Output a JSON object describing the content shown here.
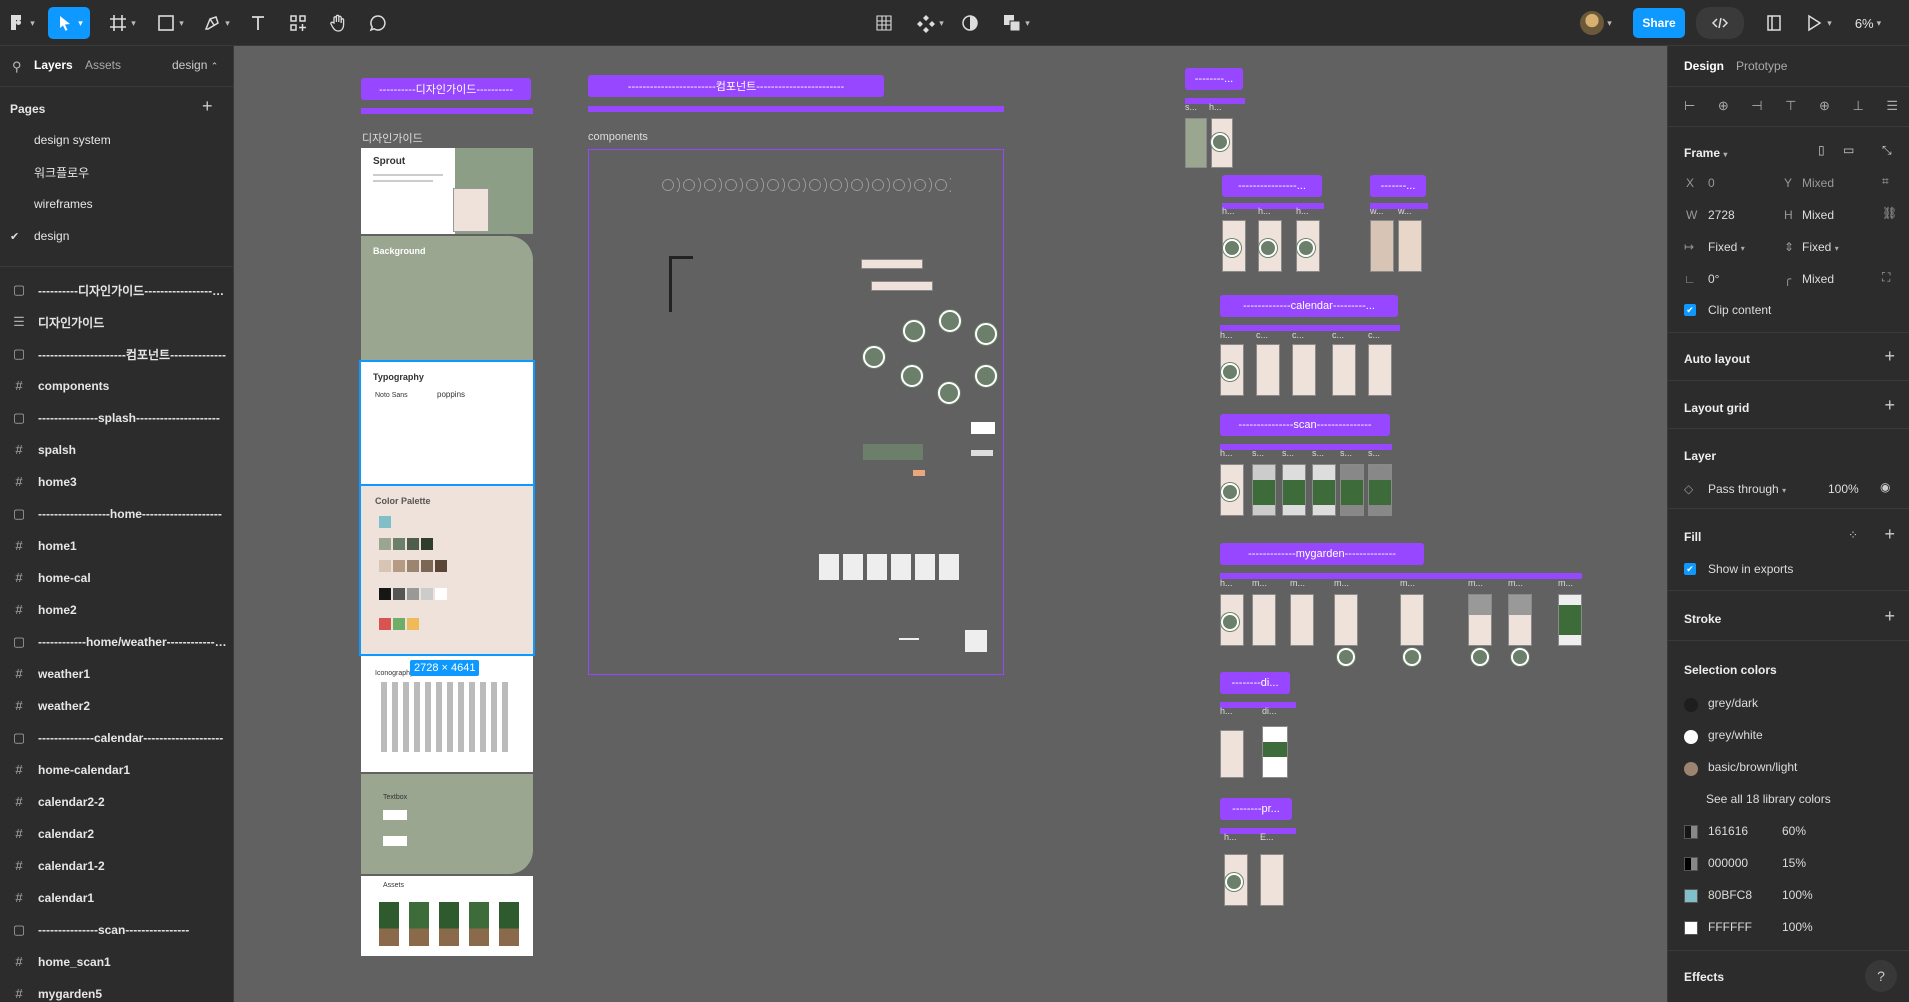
{
  "toolbar": {
    "share": "Share",
    "zoom": "6%"
  },
  "left_panel": {
    "tabs": {
      "layers": "Layers",
      "assets": "Assets",
      "page_selector": "design"
    },
    "pages_title": "Pages",
    "pages": [
      "design system",
      "워크플로우",
      "wireframes",
      "design"
    ],
    "layers": [
      {
        "name": "----------디자인가이드-------------------------",
        "type": "section"
      },
      {
        "name": "디자인가이드",
        "type": "list"
      },
      {
        "name": "----------------------컴포넌트--------------",
        "type": "section"
      },
      {
        "name": "components",
        "type": "frame"
      },
      {
        "name": "---------------splash---------------------",
        "type": "section"
      },
      {
        "name": "spalsh",
        "type": "frame"
      },
      {
        "name": "home3",
        "type": "frame"
      },
      {
        "name": "------------------home--------------------",
        "type": "section"
      },
      {
        "name": "home1",
        "type": "frame"
      },
      {
        "name": "home-cal",
        "type": "frame"
      },
      {
        "name": "home2",
        "type": "frame"
      },
      {
        "name": "------------home/weather------------------",
        "type": "section"
      },
      {
        "name": "weather1",
        "type": "frame"
      },
      {
        "name": "weather2",
        "type": "frame"
      },
      {
        "name": "--------------calendar--------------------",
        "type": "section"
      },
      {
        "name": "home-calendar1",
        "type": "frame"
      },
      {
        "name": "calendar2-2",
        "type": "frame"
      },
      {
        "name": "calendar2",
        "type": "frame"
      },
      {
        "name": "calendar1-2",
        "type": "frame"
      },
      {
        "name": "calendar1",
        "type": "frame"
      },
      {
        "name": "---------------scan----------------",
        "type": "section"
      },
      {
        "name": "home_scan1",
        "type": "frame"
      },
      {
        "name": "mygarden5",
        "type": "frame"
      }
    ]
  },
  "canvas": {
    "labels": {
      "guide": "----------디자인가이드----------",
      "components": "------------------------컴포넌트------------------------",
      "splash": "--------...",
      "home": "----------------...",
      "weather": "-------...",
      "calendar": "-------------calendar---------...",
      "scan": "---------------scan---------------",
      "mygarden": "-------------mygarden--------------",
      "di": "--------di...",
      "pr": "--------pr..."
    },
    "frame_titles": {
      "guide": "디자인가이드",
      "components": "components"
    },
    "size_badge": "2728 × 4641",
    "guide_texts": {
      "sprout": "Sprout",
      "background": "Background",
      "typography": "Typography",
      "font_a": "Noto Sans",
      "font_b": "poppins",
      "color_palette": "Color Palette",
      "iconography": "Iconography",
      "textbox": "Textbox",
      "assets": "Assets"
    },
    "thumb_names": {
      "splash": [
        "s...",
        "h..."
      ],
      "home": [
        "h...",
        "h...",
        "h..."
      ],
      "weather": [
        "w...",
        "w..."
      ],
      "calendar": [
        "h...",
        "c...",
        "c...",
        "c...",
        "c..."
      ],
      "scan": [
        "h...",
        "s...",
        "s...",
        "s...",
        "s...",
        "s..."
      ],
      "mygarden": [
        "h...",
        "m...",
        "m...",
        "m...",
        "m...",
        "m...",
        "m...",
        "m..."
      ],
      "di": [
        "h...",
        "di..."
      ],
      "pr": [
        "h...",
        "E..."
      ]
    }
  },
  "right_panel": {
    "tabs": {
      "design": "Design",
      "prototype": "Prototype"
    },
    "frame": {
      "title": "Frame",
      "x_label": "X",
      "x": "0",
      "y_label": "Y",
      "y": "Mixed",
      "w_label": "W",
      "w": "2728",
      "h_label": "H",
      "h": "Mixed",
      "horizontal_resizing": "Fixed",
      "vertical_resizing": "Fixed",
      "rotation": "0°",
      "radius": "Mixed",
      "clip_content": "Clip content"
    },
    "auto_layout": "Auto layout",
    "layout_grid": "Layout grid",
    "layer": {
      "title": "Layer",
      "blend": "Pass through",
      "opacity": "100%"
    },
    "fill": {
      "title": "Fill",
      "show_in_exports": "Show in exports"
    },
    "stroke": "Stroke",
    "selection_colors": {
      "title": "Selection colors",
      "styles": [
        {
          "name": "grey/dark",
          "color": "#1e1e1e"
        },
        {
          "name": "grey/white",
          "color": "#ffffff"
        },
        {
          "name": "basic/brown/light",
          "color": "#9b8470"
        }
      ],
      "see_all": "See all 18 library colors",
      "hex": [
        {
          "hex": "161616",
          "opacity": "60%",
          "color": "#161616"
        },
        {
          "hex": "000000",
          "opacity": "15%",
          "color": "#000000"
        },
        {
          "hex": "80BFC8",
          "opacity": "100%",
          "color": "#80bfc8"
        },
        {
          "hex": "FFFFFF",
          "opacity": "100%",
          "color": "#ffffff"
        }
      ]
    },
    "effects": "Effects",
    "help": "?"
  },
  "colors": {
    "accent": "#0d99ff",
    "section": "#9747ff",
    "canvas": "#616161",
    "sage": "#9aa690",
    "blush": "#efe2da"
  }
}
